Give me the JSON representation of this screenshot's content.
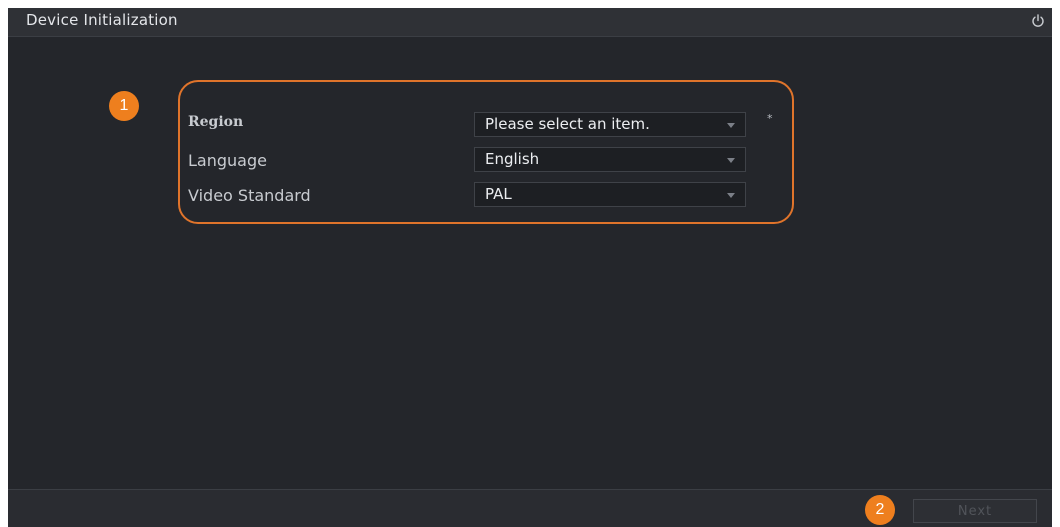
{
  "window": {
    "title": "Device Initialization",
    "power_icon": "power-icon"
  },
  "form": {
    "region": {
      "label": "Region",
      "value": "Please select an item.",
      "required_marker": "*"
    },
    "language": {
      "label": "Language",
      "value": "English"
    },
    "video_standard": {
      "label": "Video Standard",
      "value": "PAL"
    }
  },
  "callouts": {
    "one": "1",
    "two": "2"
  },
  "footer": {
    "next_label": "Next"
  },
  "colors": {
    "background": "#24262b",
    "accent": "#ee7f1e",
    "highlight_border": "#e0742b"
  }
}
